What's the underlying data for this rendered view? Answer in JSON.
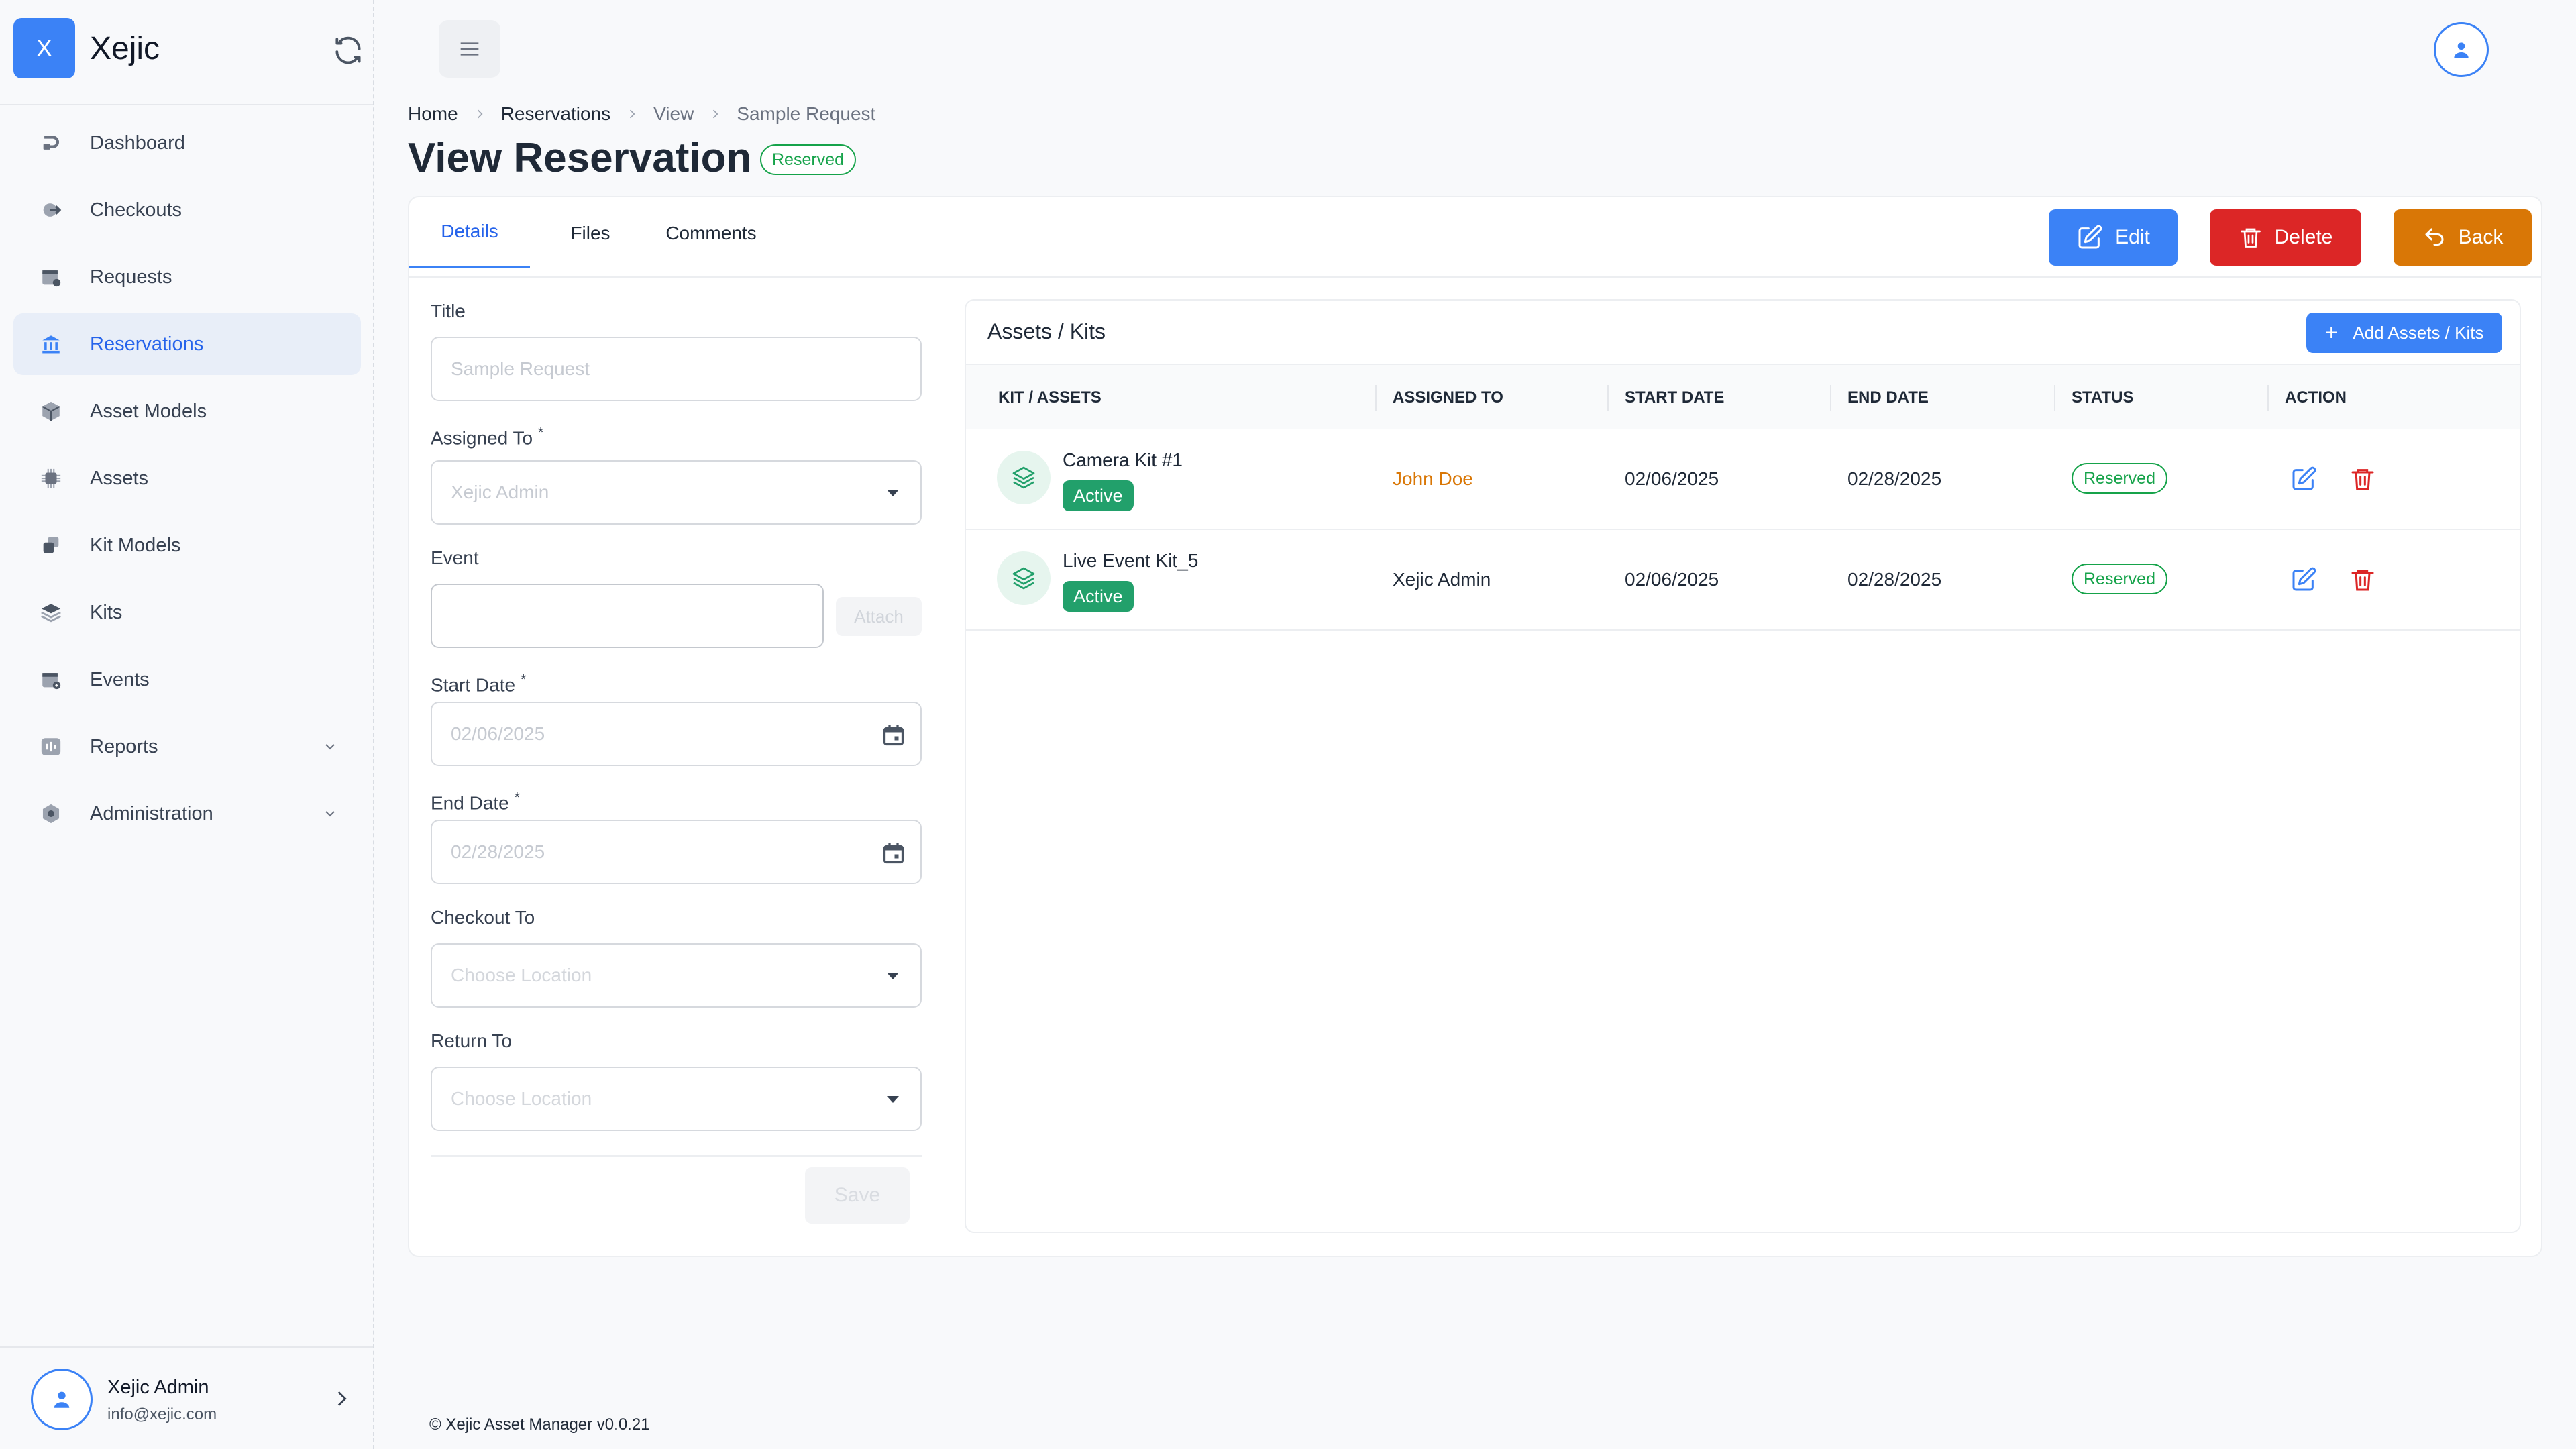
{
  "app": {
    "logo_letter": "X",
    "name": "Xejic",
    "accent_color": "#3b82f6"
  },
  "sidebar": {
    "items": [
      {
        "label": "Dashboard",
        "icon": "dashboard-icon"
      },
      {
        "label": "Checkouts",
        "icon": "checkout-icon"
      },
      {
        "label": "Requests",
        "icon": "calendar-icon"
      },
      {
        "label": "Reservations",
        "icon": "building-icon",
        "active": true
      },
      {
        "label": "Asset Models",
        "icon": "cube-icon"
      },
      {
        "label": "Assets",
        "icon": "chip-icon"
      },
      {
        "label": "Kit Models",
        "icon": "kit-model-icon"
      },
      {
        "label": "Kits",
        "icon": "layers-icon"
      },
      {
        "label": "Events",
        "icon": "event-icon"
      },
      {
        "label": "Reports",
        "icon": "report-icon",
        "expandable": true
      },
      {
        "label": "Administration",
        "icon": "admin-icon",
        "expandable": true
      }
    ],
    "user": {
      "name": "Xejic Admin",
      "email": "info@xejic.com"
    }
  },
  "breadcrumb": [
    "Home",
    "Reservations",
    "View",
    "Sample Request"
  ],
  "page": {
    "title": "View Reservation",
    "status": "Reserved"
  },
  "tabs": [
    "Details",
    "Files",
    "Comments"
  ],
  "actions": {
    "edit": "Edit",
    "delete": "Delete",
    "back": "Back"
  },
  "form": {
    "title_label": "Title",
    "title_value": "Sample Request",
    "assigned_label": "Assigned To",
    "assigned_value": "Xejic Admin",
    "event_label": "Event",
    "event_value": "",
    "attach_label": "Attach",
    "start_label": "Start Date",
    "start_value": "02/06/2025",
    "end_label": "End Date",
    "end_value": "02/28/2025",
    "checkout_label": "Checkout To",
    "checkout_placeholder": "Choose Location",
    "return_label": "Return To",
    "return_placeholder": "Choose Location",
    "required_mark": "*",
    "save_label": "Save"
  },
  "assets": {
    "title": "Assets / Kits",
    "add_label": "Add Assets / Kits",
    "columns": [
      "KIT / ASSETS",
      "ASSIGNED TO",
      "START DATE",
      "END DATE",
      "STATUS",
      "ACTION"
    ],
    "rows": [
      {
        "name": "Camera Kit #1",
        "state": "Active",
        "assigned": "John Doe",
        "assigned_color": "#d97706",
        "start": "02/06/2025",
        "end": "02/28/2025",
        "status": "Reserved"
      },
      {
        "name": "Live Event Kit_5",
        "state": "Active",
        "assigned": "Xejic Admin",
        "assigned_color": "#1f2937",
        "start": "02/06/2025",
        "end": "02/28/2025",
        "status": "Reserved"
      }
    ]
  },
  "footer": "© Xejic Asset Manager v0.0.21"
}
